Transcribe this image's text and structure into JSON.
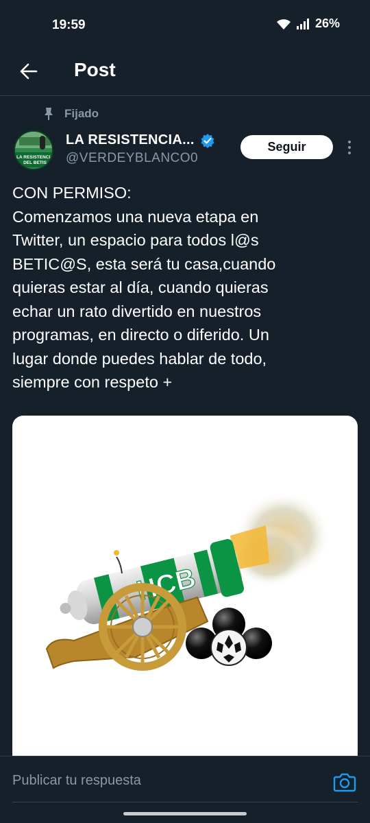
{
  "status_bar": {
    "time": "19:59",
    "battery": "26%"
  },
  "header": {
    "title": "Post"
  },
  "post": {
    "pinned_label": "Fijado",
    "author_name": "LA RESISTENCIA...",
    "author_handle": "@VERDEYBLANCO0",
    "avatar_text": "LA RESISTENCIA DEL BETIS",
    "verified": true,
    "follow_label": "Seguir",
    "text_lines": [
      "CON PERMISO:",
      "Comenzamos una nueva etapa en",
      "Twitter, un espacio para todos l@s",
      "BETIC@S, esta será tu casa,cuando",
      "quieras estar al día, cuando quieras",
      "echar un rato divertido en nuestros",
      "programas, en directo o diferido. Un",
      "lugar donde puedes hablar de todo,",
      "siempre con respeto +"
    ],
    "media_image_text": "HCB"
  },
  "reply": {
    "placeholder": "Publicar tu respuesta"
  },
  "colors": {
    "background": "#15202b",
    "accent": "#1d9bf0",
    "muted": "#8b98a5",
    "betis_green": "#0b9444"
  }
}
